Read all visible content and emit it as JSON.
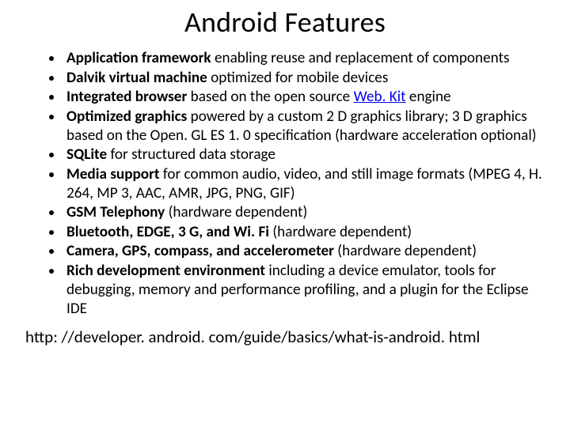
{
  "title": "Android Features",
  "items": [
    {
      "lead": "Application framework",
      "rest": " enabling reuse and replacement of components"
    },
    {
      "lead": "Dalvik virtual machine",
      "rest": " optimized for mobile devices"
    },
    {
      "lead": "Integrated browser",
      "rest_pre": " based on the open source ",
      "link_text": "Web. Kit",
      "rest_post": " engine"
    },
    {
      "lead": "Optimized graphics",
      "rest": " powered by a custom 2 D graphics library; 3 D graphics based on the Open. GL ES 1. 0 specification (hardware acceleration optional)"
    },
    {
      "lead": "SQLite",
      "rest": " for structured data storage"
    },
    {
      "lead": "Media support",
      "rest": " for common audio, video, and still image formats (MPEG 4, H. 264, MP 3, AAC, AMR, JPG, PNG, GIF)"
    },
    {
      "lead": "GSM Telephony",
      "rest": " (hardware dependent)"
    },
    {
      "lead": "Bluetooth, EDGE, 3 G, and Wi. Fi",
      "rest": " (hardware dependent)"
    },
    {
      "lead": "Camera, GPS, compass, and accelerometer",
      "rest": " (hardware dependent)"
    },
    {
      "lead": "Rich development environment",
      "rest": " including a device emulator, tools for debugging, memory and performance profiling, and a plugin for the Eclipse IDE"
    }
  ],
  "footer": "http: //developer. android. com/guide/basics/what-is-android. html"
}
